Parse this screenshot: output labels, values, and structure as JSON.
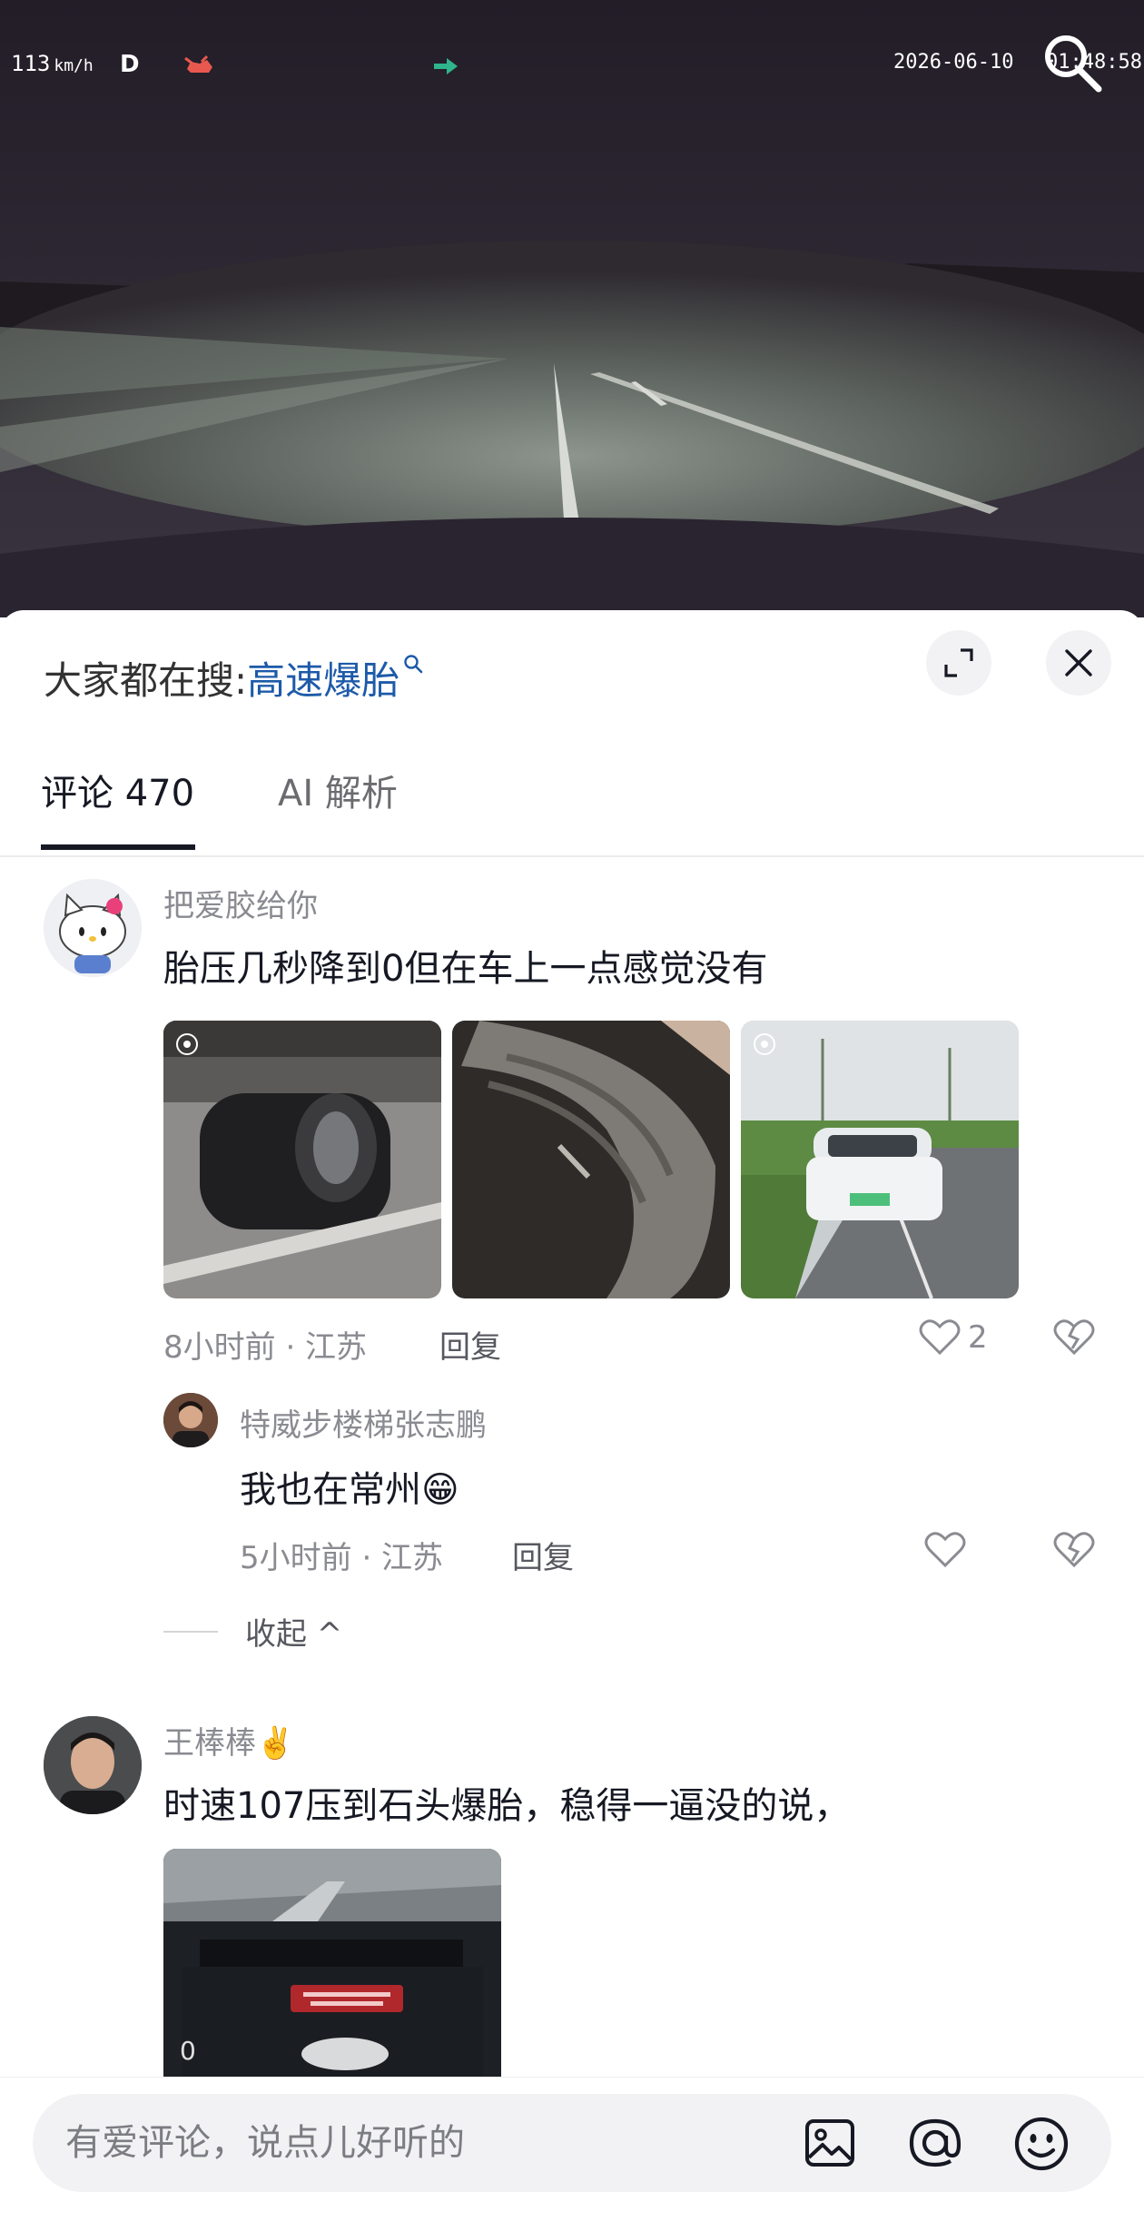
{
  "video": {
    "speed_value": "113",
    "speed_unit": "km/h",
    "gear": "D",
    "date": "2026-06-10",
    "time": "01:48:58"
  },
  "header": {
    "trending_prefix": "大家都在搜:",
    "trending_keyword": "高速爆胎"
  },
  "tabs": [
    {
      "label": "评论 470"
    },
    {
      "label": "AI 解析"
    }
  ],
  "comments": [
    {
      "username": "把爱胶给你",
      "content": "胎压几秒降到0但在车上一点感觉没有",
      "meta": "8小时前 · 江苏",
      "reply_label": "回复",
      "likes": "2",
      "photo_count": 3,
      "replies": [
        {
          "username": "特威步楼梯张志鹏",
          "content": "我也在常州😁",
          "meta": "5小时前 · 江苏",
          "reply_label": "回复"
        }
      ],
      "collapse_label": "收起 ^"
    },
    {
      "username": "王棒棒✌️",
      "content": "时速107压到石头爆胎，稳得一逼没的说，",
      "photo_count": 1
    }
  ],
  "composer": {
    "placeholder": "有爱评论，说点儿好听的"
  },
  "colors": {
    "keyword": "#1d5aa9",
    "text_primary": "#161823",
    "text_secondary": "#8a8b91"
  }
}
